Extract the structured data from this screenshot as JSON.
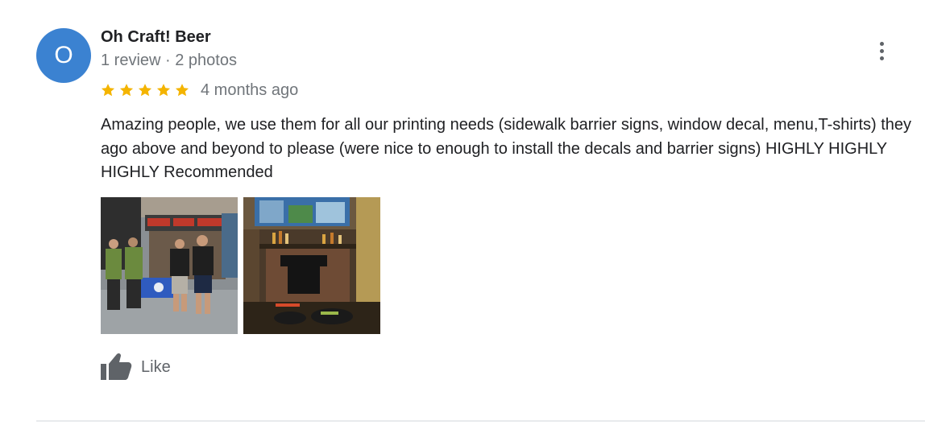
{
  "review": {
    "author": {
      "initial": "O",
      "name": "Oh Craft! Beer",
      "meta": "1 review · 2 photos"
    },
    "rating": {
      "stars": 5,
      "max_stars": 5,
      "date": "4 months ago"
    },
    "text": "Amazing people, we use them for all our printing needs (sidewalk barrier signs, window decal, menu,T-shirts) they ago above and beyond to please (were nice to enough to install the decals and barrier signs) HIGHLY HIGHLY HIGHLY Recommended",
    "photos": [
      {
        "name": "photo-storefront-group"
      },
      {
        "name": "photo-bar-tshirt"
      }
    ],
    "actions": {
      "like_label": "Like",
      "more_icon": "more-vertical-icon",
      "like_icon": "thumbs-up-icon"
    }
  },
  "colors": {
    "avatar": "#3b82d1",
    "star": "#f4b400",
    "secondary_text": "#70757a",
    "primary_text": "#202124"
  }
}
